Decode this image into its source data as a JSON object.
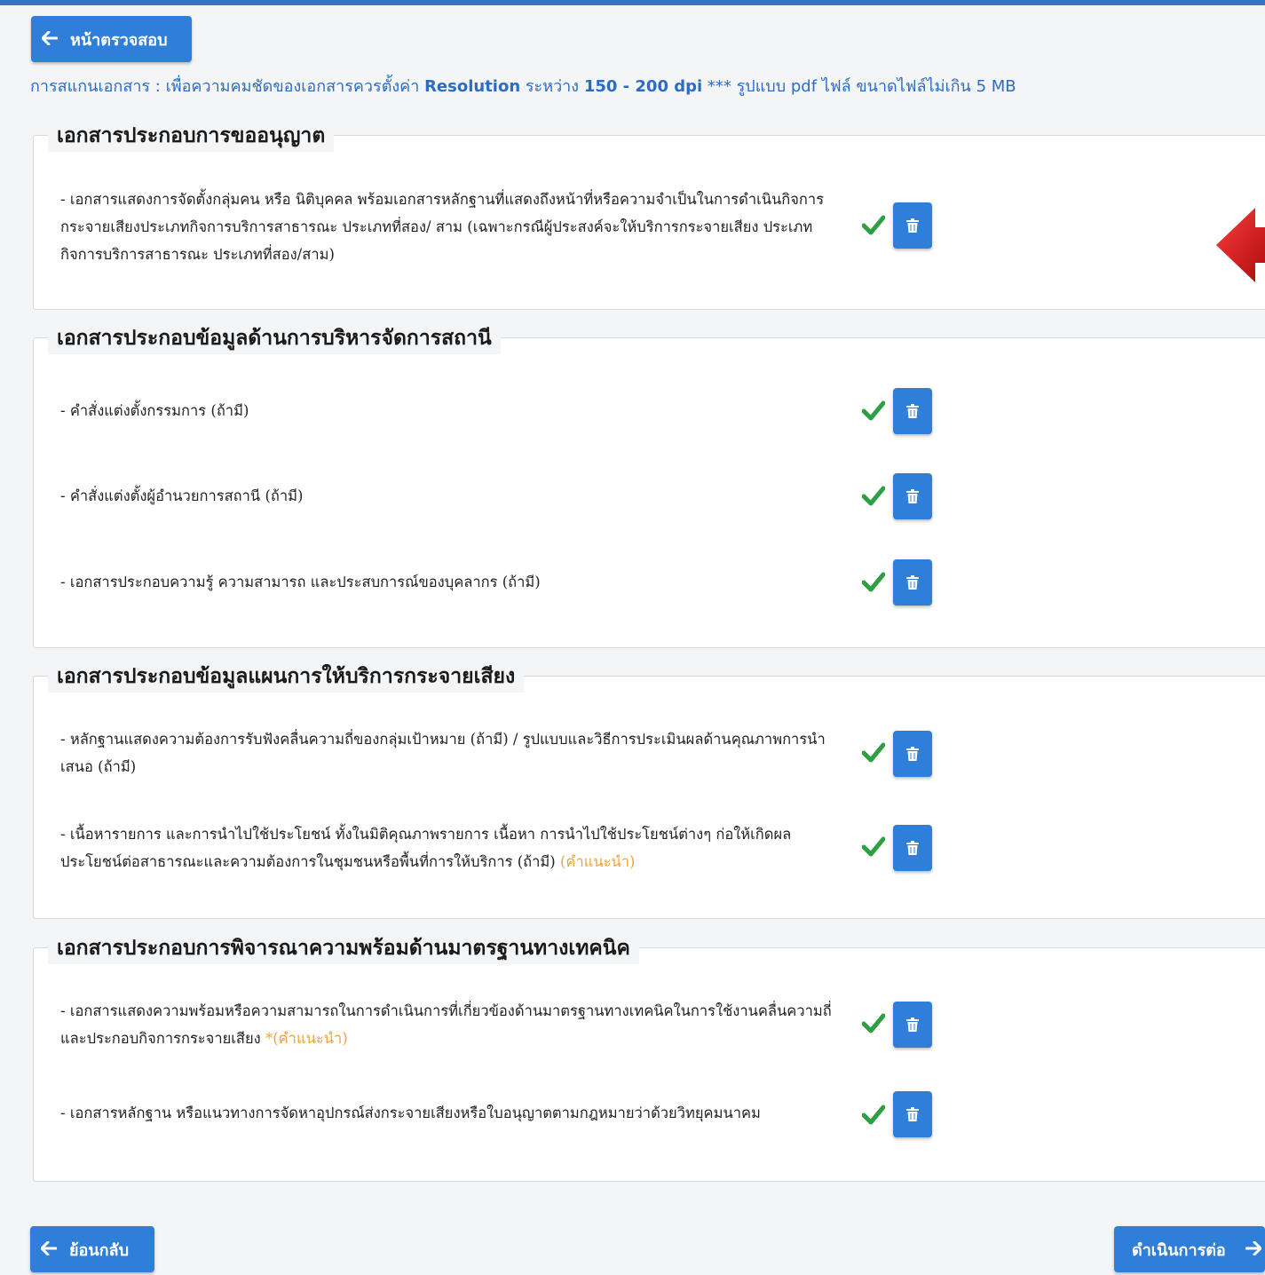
{
  "header": {
    "back_label": "หน้าตรวจสอบ"
  },
  "notice": {
    "prefix": "การสแกนเอกสาร : เพื่อความคมชัดของเอกสารควรตั้งค่า ",
    "resolution_word": "Resolution",
    "between": " ระหว่าง ",
    "dpi_range": "150 - 200 dpi",
    "suffix": " *** รูปแบบ pdf ไฟล์ ขนาดไฟล์ไม่เกิน 5 MB"
  },
  "sections": [
    {
      "title": "เอกสารประกอบการขออนุญาต",
      "items": [
        {
          "text": "- เอกสารแสดงการจัดตั้งกลุ่มคน หรือ นิติบุคคล พร้อมเอกสารหลักฐานที่แสดงถึงหน้าที่หรือความจำเป็นในการดำเนินกิจการกระจายเสียงประเภทกิจการบริการสาธารณะ ประเภทที่สอง/ สาม (เฉพาะกรณีผู้ประสงค์จะให้บริการกระจายเสียง ประเภทกิจการบริการสาธารณะ ประเภทที่สอง/สาม)"
        }
      ]
    },
    {
      "title": "เอกสารประกอบข้อมูลด้านการบริหารจัดการสถานี",
      "items": [
        {
          "text": "- คำสั่งแต่งตั้งกรรมการ (ถ้ามี)"
        },
        {
          "text": "- คำสั่งแต่งตั้งผู้อำนวยการสถานี (ถ้ามี)"
        },
        {
          "text": "- เอกสารประกอบความรู้ ความสามารถ และประสบการณ์ของบุคลากร (ถ้ามี)"
        }
      ]
    },
    {
      "title": "เอกสารประกอบข้อมูลแผนการให้บริการกระจายเสียง",
      "items": [
        {
          "text": "- หลักฐานแสดงความต้องการรับฟังคลื่นความถี่ของกลุ่มเป้าหมาย (ถ้ามี) / รูปแบบและวิธีการประเมินผลด้านคุณภาพการนำเสนอ (ถ้ามี)"
        },
        {
          "text": "- เนื้อหารายการ และการนำไปใช้ประโยชน์ ทั้งในมิติคุณภาพรายการ เนื้อหา การนำไปใช้ประโยชน์ต่างๆ ก่อให้เกิดผลประโยชน์ต่อสาธารณะและความต้องการในชุมชนหรือพื้นที่การให้บริการ (ถ้ามี) ",
          "hint": "(คำแนะนำ)"
        }
      ]
    },
    {
      "title": "เอกสารประกอบการพิจารณาความพร้อมด้านมาตรฐานทางเทคนิค",
      "items": [
        {
          "text": "- เอกสารแสดงความพร้อมหรือความสามารถในการดำเนินการที่เกี่ยวข้องด้านมาตรฐานทางเทคนิคในการใช้งานคลื่นความถี่และประกอบกิจการกระจายเสียง ",
          "hint": "*(คำแนะนำ)"
        },
        {
          "text": "- เอกสารหลักฐาน หรือแนวทางการจัดหาอุปกรณ์ส่งกระจายเสียงหรือใบอนุญาตตามกฎหมายว่าด้วยวิทยุคมนาคม"
        }
      ]
    }
  ],
  "footer": {
    "back_label": "ย้อนกลับ",
    "next_label": "ดำเนินการต่อ"
  },
  "colors": {
    "primary": "#2f7fd8",
    "check": "#2ea043",
    "hint": "#f0a23a",
    "notice": "#2b6cc4",
    "marker": "#d41313"
  },
  "icons": [
    "arrow-left-icon",
    "arrow-right-icon",
    "checkmark-icon",
    "trash-icon"
  ]
}
